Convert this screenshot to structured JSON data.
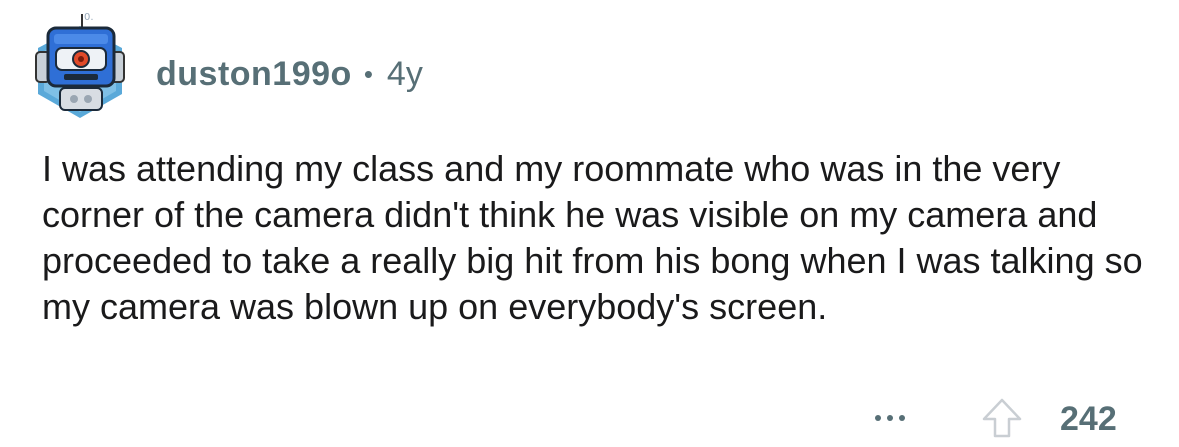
{
  "comment": {
    "author": "duston199o",
    "separator": "•",
    "age": "4y",
    "body": "I was attending my class and my roommate who was in the very corner of the camera didn't think he was visible on my camera and proceeded to take a really big hit from his bong when I was talking so my camera was blown up on everybody's screen.",
    "score": "242"
  },
  "icons": {
    "avatar": "robot-avatar-icon",
    "more": "more-options-icon",
    "upvote": "upvote-arrow-icon"
  },
  "colors": {
    "meta_text": "#576f76",
    "body_text": "#1a1a1b",
    "avatar_blue": "#2f6fd6",
    "avatar_hex_bg": "#5aa9d9"
  }
}
